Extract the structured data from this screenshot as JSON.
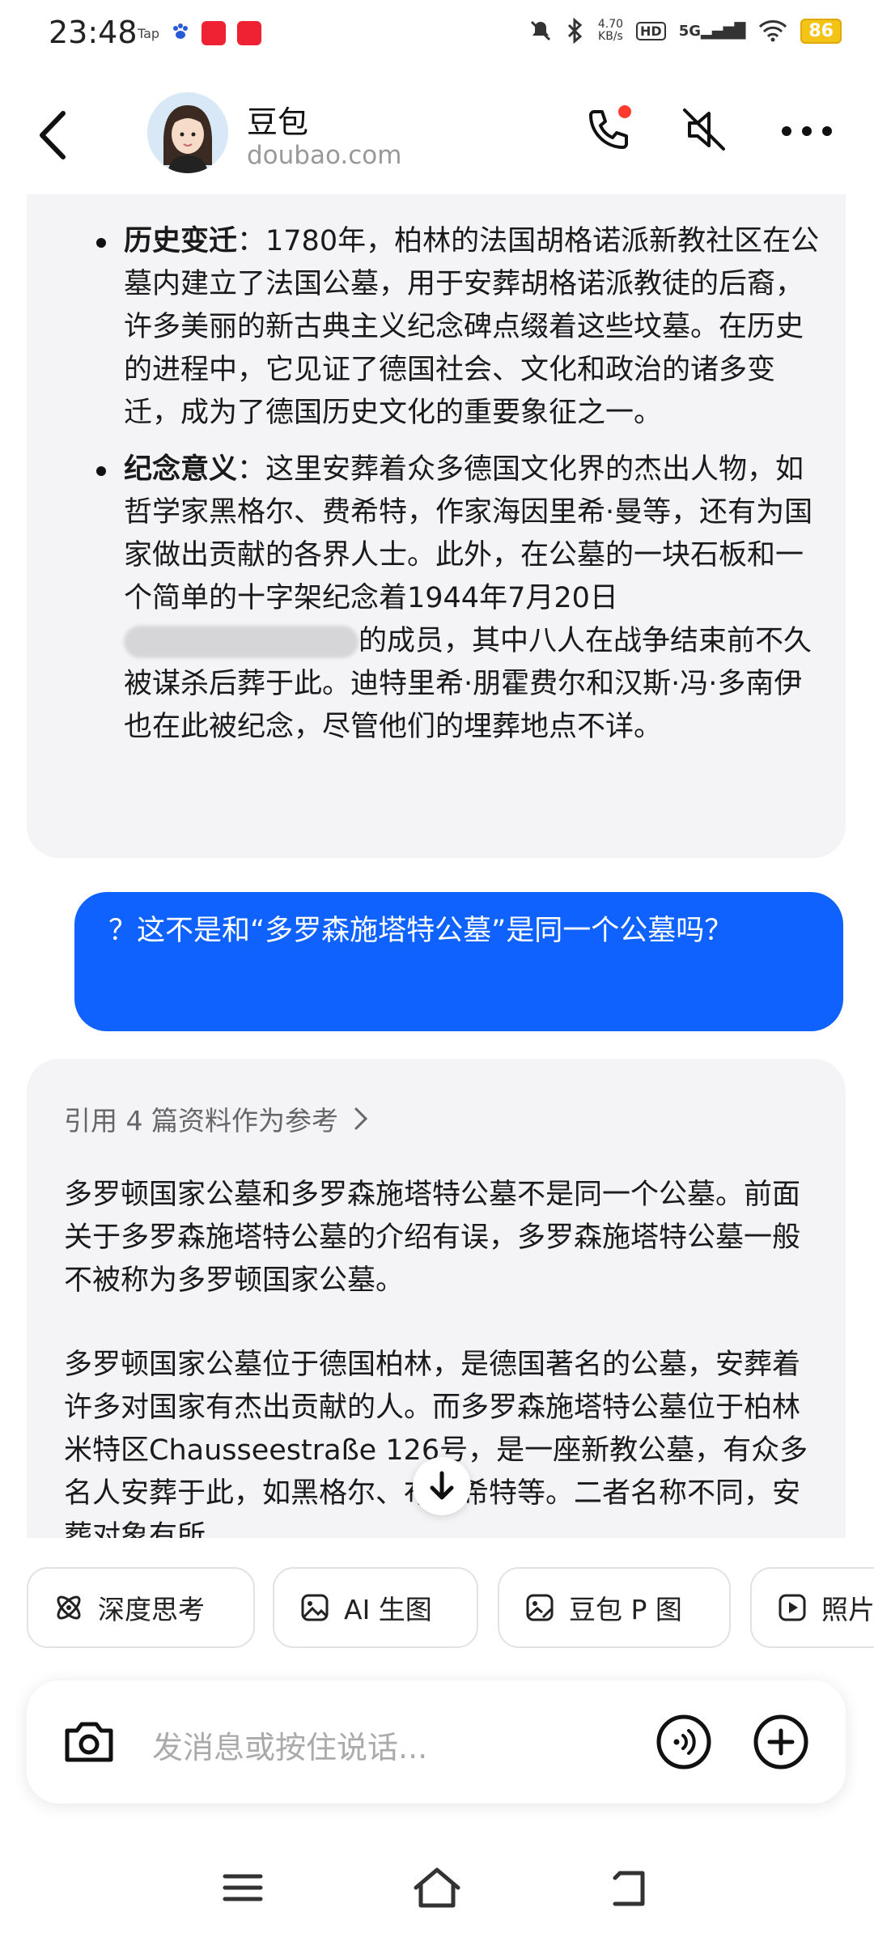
{
  "status_bar": {
    "time": "23:48",
    "apps": [
      "Tap",
      "百度",
      "拼多多",
      "小红书"
    ],
    "net_speed_value": "4.70",
    "net_speed_unit": "KB/s",
    "hd": "HD",
    "signal": "5G",
    "battery": "86"
  },
  "header": {
    "title": "豆包",
    "subtitle": "doubao.com"
  },
  "chat": {
    "ai_message_1": {
      "bullets": [
        {
          "heading": "历史变迁",
          "text": "：1780年，柏林的法国胡格诺派新教社区在公墓内建立了法国公墓，用于安葬胡格诺派教徒的后裔，许多美丽的新古典主义纪念碑点缀着这些坟墓。在历史的进程中，它见证了德国社会、文化和政治的诸多变迁，成为了德国历史文化的重要象征之一。"
        },
        {
          "heading": "纪念意义",
          "text_before": "：这里安葬着众多德国文化界的杰出人物，如哲学家黑格尔、费希特，作家海因里希·曼等，还有为国家做出贡献的各界人士。此外，在公墓的一块石板和一个简单的十字架纪念着1944年7月20日",
          "text_after": "的成员，其中八人在战争结束前不久被谋杀后葬于此。迪特里希·朋霍费尔和汉斯·冯·多南伊也在此被纪念，尽管他们的埋葬地点不详。"
        }
      ]
    },
    "user_message": "？这不是和“多罗森施塔特公墓”是同一个公墓吗？",
    "ai_message_2": {
      "references": "引用 4 篇资料作为参考",
      "para1": "多罗顿国家公墓和多罗森施塔特公墓不是同一个公墓。前面关于多罗森施塔特公墓的介绍有误，多罗森施塔特公墓一般不被称为多罗顿国家公墓。",
      "para2": "多罗顿国家公墓位于德国柏林，是德国著名的公墓，安葬着许多对国家有杰出贡献的人。而多罗森施塔特公墓位于柏林米特区Chausseestraße 126号，是一座新教公墓，有众多名人安葬于此，如黑格尔、布莱希特等。二者名称不同，安葬对象有所"
    }
  },
  "chips": [
    {
      "label": "深度思考",
      "icon": "atom-icon"
    },
    {
      "label": "AI 生图",
      "icon": "image-icon"
    },
    {
      "label": "豆包 P 图",
      "icon": "image-edit-icon"
    },
    {
      "label": "照片",
      "icon": "video-icon"
    }
  ],
  "input": {
    "placeholder": "发消息或按住说话..."
  },
  "colors": {
    "accent": "#0f62fe",
    "ai_bubble": "#f4f4f6",
    "battery": "#f3c316"
  }
}
